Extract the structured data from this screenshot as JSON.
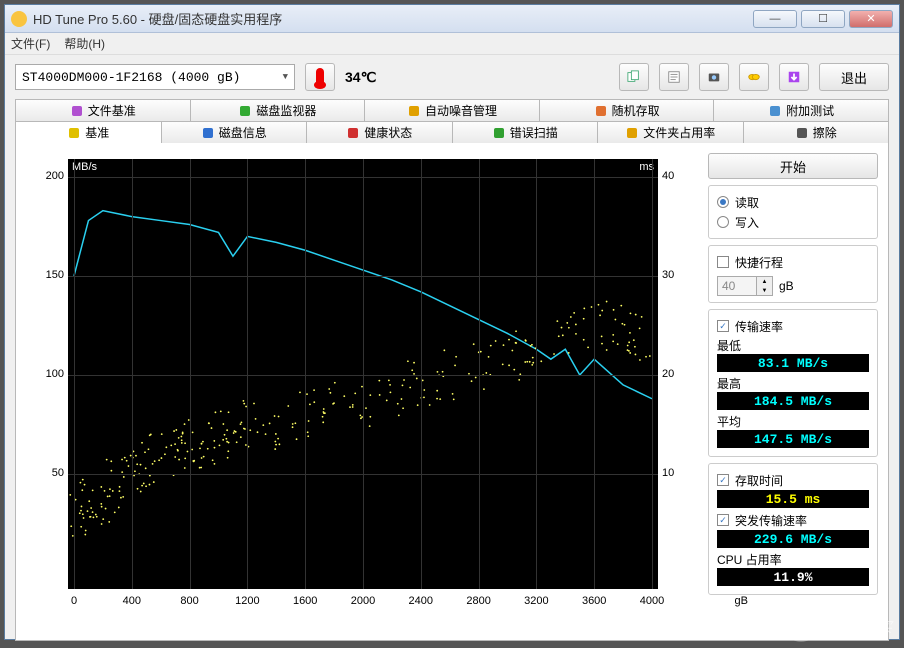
{
  "window": {
    "title": "HD Tune Pro 5.60 - 硬盘/固态硬盘实用程序",
    "minimize": "—",
    "maximize": "☐",
    "close": "✕"
  },
  "menu": {
    "file": "文件(F)",
    "help": "帮助(H)"
  },
  "toolbar": {
    "drive": "ST4000DM000-1F2168 (4000 gB)",
    "temp": "34℃",
    "exit": "退出"
  },
  "tabs_row1": [
    {
      "label": "文件基准",
      "color": "#b050d0"
    },
    {
      "label": "磁盘监视器",
      "color": "#33aa33"
    },
    {
      "label": "自动噪音管理",
      "color": "#e0a000"
    },
    {
      "label": "随机存取",
      "color": "#e07030"
    },
    {
      "label": "附加测试",
      "color": "#4a90d0"
    }
  ],
  "tabs_row2": [
    {
      "label": "基准",
      "color": "#e0c000",
      "active": true
    },
    {
      "label": "磁盘信息",
      "color": "#3070d0"
    },
    {
      "label": "健康状态",
      "color": "#d03030"
    },
    {
      "label": "错误扫描",
      "color": "#30a030"
    },
    {
      "label": "文件夹占用率",
      "color": "#e0a000"
    },
    {
      "label": "擦除",
      "color": "#555"
    }
  ],
  "side": {
    "start": "开始",
    "read": "读取",
    "write": "写入",
    "short_stroke": "快捷行程",
    "stroke_val": "40",
    "stroke_unit": "gB",
    "transfer": "传输速率",
    "min_lbl": "最低",
    "min_val": "83.1 MB/s",
    "max_lbl": "最高",
    "max_val": "184.5 MB/s",
    "avg_lbl": "平均",
    "avg_val": "147.5 MB/s",
    "access_lbl": "存取时间",
    "access_val": "15.5 ms",
    "burst_lbl": "突发传输速率",
    "burst_val": "229.6 MB/s",
    "cpu_lbl": "CPU 占用率",
    "cpu_val": "11.9%"
  },
  "chart_data": {
    "type": "line",
    "title": "",
    "x_unit": "gB",
    "y_left_unit": "MB/s",
    "y_right_unit": "ms",
    "xlim": [
      0,
      4000
    ],
    "ylim_left": [
      0,
      200
    ],
    "ylim_right": [
      0,
      40
    ],
    "x_ticks": [
      0,
      400,
      800,
      1200,
      1600,
      2000,
      2400,
      2800,
      3200,
      3600,
      4000
    ],
    "y_left_ticks": [
      50,
      100,
      150,
      200
    ],
    "y_right_ticks": [
      10,
      20,
      30,
      40
    ],
    "series": [
      {
        "name": "transfer_rate_mb_s",
        "axis": "left",
        "x": [
          0,
          100,
          200,
          400,
          600,
          800,
          1000,
          1100,
          1200,
          1400,
          1600,
          1800,
          2000,
          2200,
          2400,
          2600,
          2800,
          3000,
          3200,
          3300,
          3400,
          3500,
          3600,
          3800,
          4000
        ],
        "y": [
          150,
          178,
          183,
          180,
          178,
          176,
          172,
          160,
          170,
          167,
          163,
          158,
          153,
          148,
          142,
          135,
          128,
          121,
          113,
          108,
          113,
          100,
          108,
          95,
          88
        ]
      },
      {
        "name": "access_time_ms",
        "axis": "right",
        "type": "scatter",
        "x": [
          50,
          120,
          200,
          300,
          400,
          500,
          600,
          700,
          800,
          900,
          1000,
          1100,
          1200,
          1400,
          1600,
          1800,
          2000,
          2200,
          2400,
          2600,
          2800,
          3000,
          3200,
          3400,
          3600,
          3800,
          3900
        ],
        "y": [
          6,
          7,
          7,
          9,
          10,
          11,
          12,
          12,
          13,
          13,
          14,
          14,
          15,
          15,
          16,
          17,
          17,
          18,
          19,
          20,
          21,
          22,
          23,
          24,
          25,
          25,
          24
        ]
      }
    ]
  },
  "watermark": "什么值得买"
}
